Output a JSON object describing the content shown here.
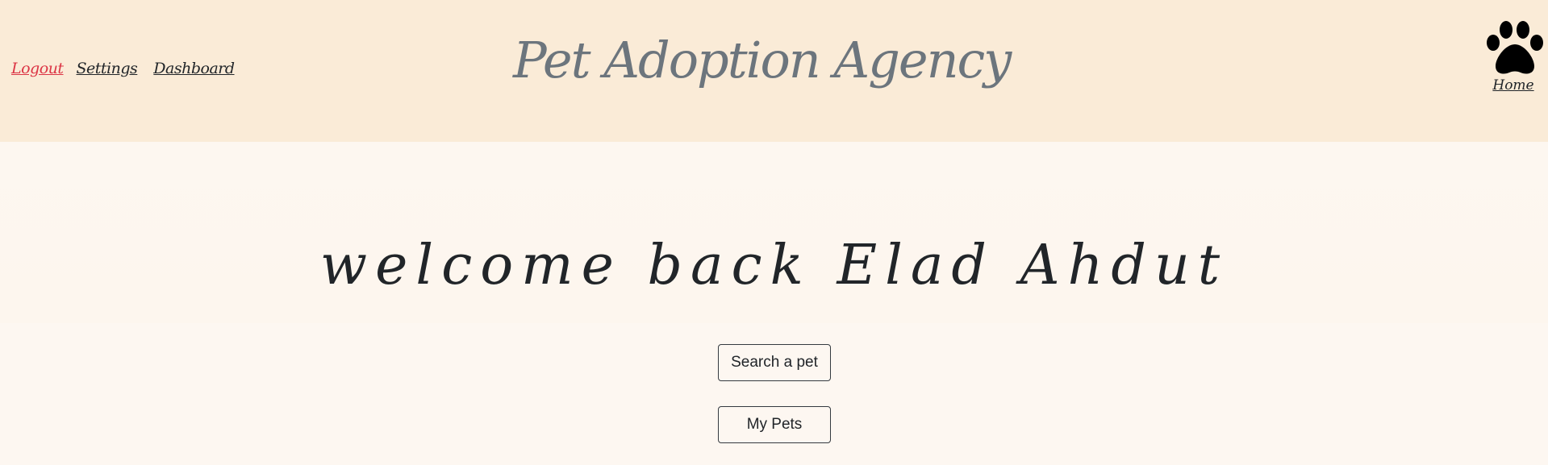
{
  "nav": {
    "logout_label": "Logout",
    "settings_label": "Settings",
    "dashboard_label": "Dashboard"
  },
  "brand": {
    "title": "Pet Adoption Agency"
  },
  "home": {
    "icon": "paw-icon",
    "label": "Home"
  },
  "main": {
    "welcome_text": "welcome back Elad Ahdut",
    "search_button_label": "Search a pet",
    "my_pets_button_label": "My Pets"
  },
  "colors": {
    "header_bg": "#faebd7",
    "page_bg": "#fdf7f1",
    "logout": "#dc3545",
    "brand_text": "#6c757d",
    "text": "#212529"
  }
}
